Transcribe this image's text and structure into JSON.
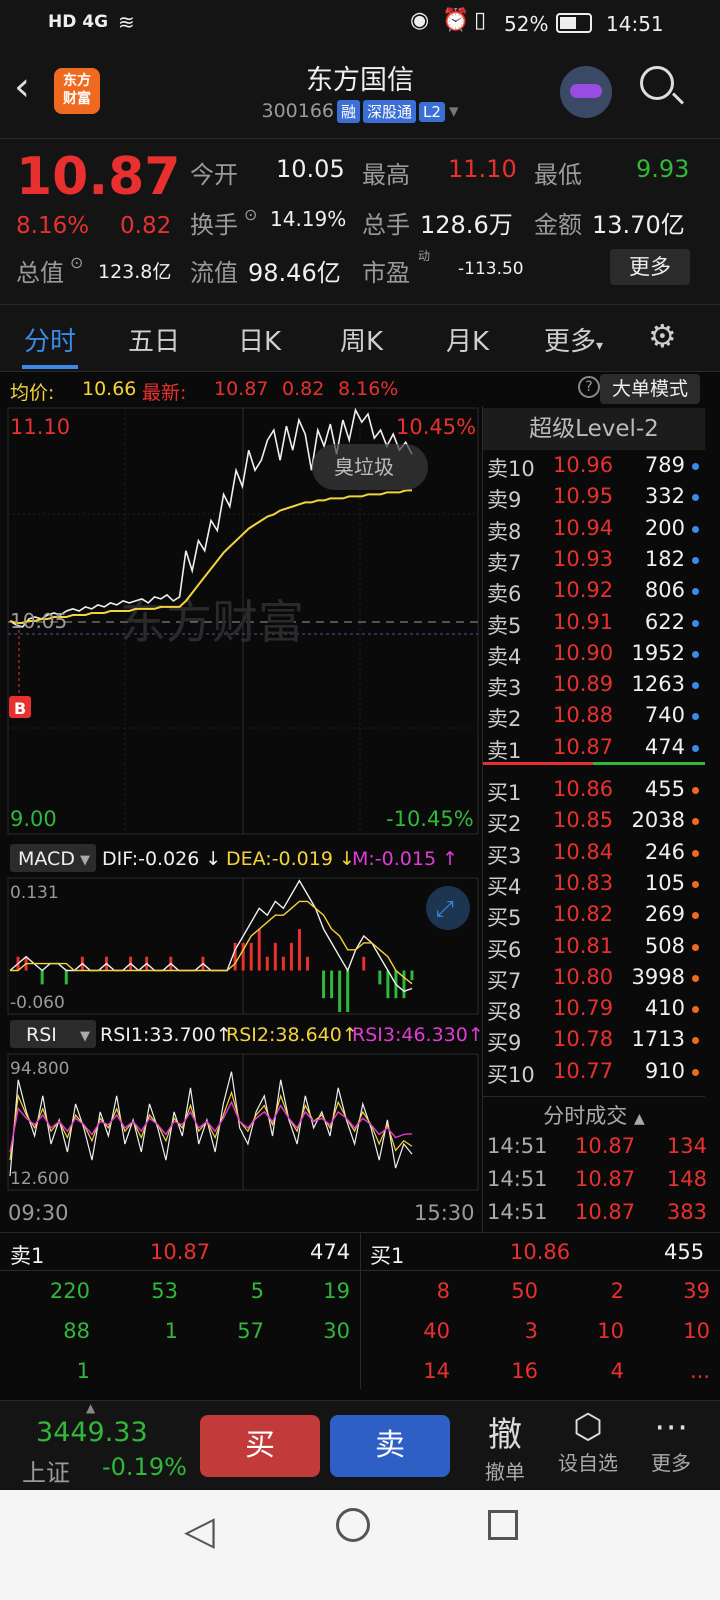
{
  "status_bar": {
    "left_icons": "HD 4G",
    "battery": "52%",
    "time": "14:51"
  },
  "header": {
    "logo_line1": "东方",
    "logo_line2": "财富",
    "title": "东方国信",
    "code": "300166",
    "badge_margin": "融",
    "badge_connect": "深股通",
    "badge_level": "L2"
  },
  "quote": {
    "price": "10.87",
    "change_pct": "8.16%",
    "change": "0.82",
    "open_label": "今开",
    "open": "10.05",
    "high_label": "最高",
    "high": "11.10",
    "low_label": "最低",
    "low": "9.93",
    "turnover_label": "换手",
    "turnover": "14.19%",
    "volume_label": "总手",
    "volume": "128.6万",
    "amount_label": "金额",
    "amount": "13.70亿",
    "mcap_label": "总值",
    "mcap": "123.8亿",
    "float_label": "流值",
    "float": "98.46亿",
    "pe_label": "市盈",
    "pe_sup": "动",
    "pe": "-113.50",
    "more_button": "更多"
  },
  "tabs": [
    "分时",
    "五日",
    "日K",
    "周K",
    "月K",
    "更多"
  ],
  "chart_header": {
    "avg_label": "均价:",
    "avg": "10.66",
    "latest_label": "最新:",
    "latest": "10.87",
    "change": "0.82",
    "pct": "8.16%",
    "mode_button": "大单模式"
  },
  "chart_data": [
    {
      "type": "line",
      "title": "",
      "ylim": [
        9.0,
        11.1
      ],
      "price_labels": {
        "top_left": "11.10",
        "top_right": "10.45%",
        "bottom_left": "9.00",
        "bottom_right": "-10.45%",
        "ref": "10.05"
      },
      "x_labels": [
        "09:30",
        "15:30"
      ],
      "series": [
        {
          "name": "",
          "color": "#f0f0f0",
          "values": [
            10.05,
            10.03,
            10.02,
            10.06,
            10.07,
            10.06,
            10.08,
            10.09,
            10.08,
            10.1,
            10.11,
            10.1,
            10.12,
            10.11,
            10.13,
            10.12,
            10.14,
            10.13,
            10.15,
            10.14,
            10.15,
            10.16,
            10.14,
            10.17,
            10.16,
            10.18,
            10.15,
            10.17,
            10.4,
            10.3,
            10.45,
            10.4,
            10.55,
            10.5,
            10.68,
            10.62,
            10.8,
            10.72,
            10.9,
            10.8,
            10.85,
            10.95,
            11.0,
            10.85,
            11.02,
            10.9,
            11.05,
            10.98,
            10.8,
            11.0,
            10.92,
            11.03,
            10.88,
            11.05,
            10.95,
            11.1,
            11.04,
            11.08,
            10.96,
            11.0,
            10.92,
            10.98,
            10.9,
            10.94,
            10.88
          ]
        },
        {
          "name": "",
          "color": "#f3d33c",
          "values": [
            10.05,
            10.04,
            10.04,
            10.05,
            10.05,
            10.06,
            10.06,
            10.07,
            10.07,
            10.07,
            10.08,
            10.08,
            10.08,
            10.09,
            10.09,
            10.09,
            10.1,
            10.1,
            10.1,
            10.1,
            10.11,
            10.11,
            10.11,
            10.11,
            10.12,
            10.12,
            10.12,
            10.12,
            10.15,
            10.19,
            10.23,
            10.27,
            10.31,
            10.35,
            10.39,
            10.42,
            10.45,
            10.48,
            10.51,
            10.53,
            10.55,
            10.57,
            10.58,
            10.6,
            10.61,
            10.62,
            10.63,
            10.64,
            10.64,
            10.65,
            10.65,
            10.66,
            10.66,
            10.66,
            10.67,
            10.67,
            10.67,
            10.68,
            10.68,
            10.68,
            10.69,
            10.69,
            10.69,
            10.7,
            10.7
          ]
        }
      ]
    },
    {
      "type": "line",
      "title": "MACD",
      "ylim": [
        -0.06,
        0.131
      ],
      "y_labels": [
        "0.131",
        "-0.060"
      ],
      "readout": {
        "dif": "DIF:-0.026",
        "dea": "DEA:-0.019",
        "m": "M:-0.015"
      },
      "series": [
        {
          "name": "DIF",
          "color": "#f0f0f0",
          "values": [
            0.0,
            0.01,
            0.02,
            0.01,
            0.0,
            0.01,
            0.01,
            0.0,
            0.0,
            0.01,
            0.0,
            0.0,
            0.01,
            0.0,
            0.0,
            0.01,
            0.0,
            0.01,
            0.0,
            0.0,
            0.01,
            0.0,
            0.0,
            0.0,
            0.01,
            0.0,
            0.0,
            0.0,
            0.03,
            0.05,
            0.07,
            0.09,
            0.08,
            0.1,
            0.09,
            0.11,
            0.13,
            0.11,
            0.09,
            0.06,
            0.04,
            0.02,
            0.0,
            0.03,
            0.05,
            0.04,
            0.02,
            0.0,
            -0.02,
            -0.03,
            -0.026
          ]
        },
        {
          "name": "DEA",
          "color": "#f3d33c",
          "values": [
            0.0,
            0.0,
            0.01,
            0.01,
            0.01,
            0.01,
            0.01,
            0.01,
            0.0,
            0.0,
            0.0,
            0.0,
            0.0,
            0.0,
            0.0,
            0.0,
            0.0,
            0.0,
            0.0,
            0.0,
            0.0,
            0.0,
            0.0,
            0.0,
            0.0,
            0.0,
            0.0,
            0.0,
            0.01,
            0.03,
            0.05,
            0.06,
            0.07,
            0.08,
            0.08,
            0.09,
            0.1,
            0.1,
            0.09,
            0.08,
            0.06,
            0.05,
            0.03,
            0.03,
            0.04,
            0.04,
            0.03,
            0.02,
            0.0,
            -0.01,
            -0.019
          ]
        }
      ]
    },
    {
      "type": "line",
      "title": "RSI",
      "ylim": [
        12.6,
        94.8
      ],
      "y_labels": [
        "94.800",
        "12.600"
      ],
      "readout": {
        "rsi1": "RSI1:33.700",
        "rsi2": "RSI2:38.640",
        "rsi3": "RSI3:46.330"
      },
      "series": [
        {
          "name": "RSI1",
          "color": "#f0f0f0",
          "values": [
            20,
            80,
            60,
            45,
            70,
            40,
            55,
            35,
            65,
            50,
            30,
            60,
            45,
            70,
            40,
            55,
            35,
            65,
            50,
            30,
            60,
            45,
            75,
            40,
            55,
            35,
            65,
            85,
            50,
            40,
            60,
            70,
            45,
            80,
            55,
            40,
            70,
            50,
            60,
            45,
            75,
            55,
            40,
            65,
            50,
            30,
            55,
            25,
            40,
            33.7
          ]
        },
        {
          "name": "RSI2",
          "color": "#f3d33c",
          "values": [
            30,
            70,
            58,
            50,
            62,
            48,
            54,
            44,
            58,
            52,
            42,
            56,
            50,
            62,
            48,
            54,
            44,
            58,
            52,
            42,
            56,
            50,
            64,
            48,
            54,
            44,
            58,
            72,
            54,
            48,
            58,
            64,
            52,
            70,
            56,
            48,
            64,
            54,
            58,
            50,
            66,
            56,
            48,
            60,
            52,
            40,
            52,
            36,
            42,
            38.64
          ]
        },
        {
          "name": "RSI3",
          "color": "#e23cd8",
          "values": [
            35,
            62,
            56,
            52,
            58,
            50,
            54,
            48,
            56,
            52,
            46,
            54,
            52,
            58,
            50,
            54,
            48,
            56,
            52,
            46,
            54,
            52,
            60,
            50,
            54,
            48,
            56,
            66,
            54,
            50,
            56,
            60,
            54,
            64,
            56,
            50,
            60,
            54,
            56,
            52,
            60,
            56,
            50,
            56,
            52,
            46,
            50,
            44,
            46,
            46.33
          ]
        }
      ]
    }
  ],
  "level2_title": "超级Level-2",
  "order_book": {
    "sell": [
      {
        "label": "卖10",
        "price": "10.96",
        "vol": "789"
      },
      {
        "label": "卖9",
        "price": "10.95",
        "vol": "332"
      },
      {
        "label": "卖8",
        "price": "10.94",
        "vol": "200"
      },
      {
        "label": "卖7",
        "price": "10.93",
        "vol": "182"
      },
      {
        "label": "卖6",
        "price": "10.92",
        "vol": "806"
      },
      {
        "label": "卖5",
        "price": "10.91",
        "vol": "622"
      },
      {
        "label": "卖4",
        "price": "10.90",
        "vol": "1952"
      },
      {
        "label": "卖3",
        "price": "10.89",
        "vol": "1263"
      },
      {
        "label": "卖2",
        "price": "10.88",
        "vol": "740"
      },
      {
        "label": "卖1",
        "price": "10.87",
        "vol": "474"
      }
    ],
    "buy": [
      {
        "label": "买1",
        "price": "10.86",
        "vol": "455"
      },
      {
        "label": "买2",
        "price": "10.85",
        "vol": "2038"
      },
      {
        "label": "买3",
        "price": "10.84",
        "vol": "246"
      },
      {
        "label": "买4",
        "price": "10.83",
        "vol": "105"
      },
      {
        "label": "买5",
        "price": "10.82",
        "vol": "269"
      },
      {
        "label": "买6",
        "price": "10.81",
        "vol": "508"
      },
      {
        "label": "买7",
        "price": "10.80",
        "vol": "3998"
      },
      {
        "label": "买8",
        "price": "10.79",
        "vol": "410"
      },
      {
        "label": "买9",
        "price": "10.78",
        "vol": "1713"
      },
      {
        "label": "买10",
        "price": "10.77",
        "vol": "910"
      }
    ]
  },
  "timeline": {
    "title": "分时成交",
    "rows": [
      {
        "time": "14:51",
        "price": "10.87",
        "vol": "134"
      },
      {
        "time": "14:51",
        "price": "10.87",
        "vol": "148"
      },
      {
        "time": "14:51",
        "price": "10.87",
        "vol": "383"
      }
    ]
  },
  "queue": {
    "sell_label": "卖1",
    "sell_price": "10.87",
    "sell_vol": "474",
    "buy_label": "买1",
    "buy_price": "10.86",
    "buy_vol": "455",
    "sell_rows": [
      [
        "220",
        "53",
        "5",
        "19"
      ],
      [
        "88",
        "1",
        "57",
        "30"
      ],
      [
        "1",
        "",
        "",
        ""
      ]
    ],
    "buy_rows": [
      [
        "8",
        "50",
        "2",
        "39"
      ],
      [
        "40",
        "3",
        "10",
        "10"
      ],
      [
        "14",
        "16",
        "4",
        "..."
      ]
    ]
  },
  "bottom": {
    "index_value": "3449.33",
    "index_name": "上证",
    "index_change": "-0.19%",
    "buy_button": "买",
    "sell_button": "卖",
    "cancel_icon_text": "撤",
    "cancel_label": "撤单",
    "watch_label": "设自选",
    "more_label": "更多"
  },
  "watermark": "东方财富",
  "ad_text": "臭垃圾"
}
